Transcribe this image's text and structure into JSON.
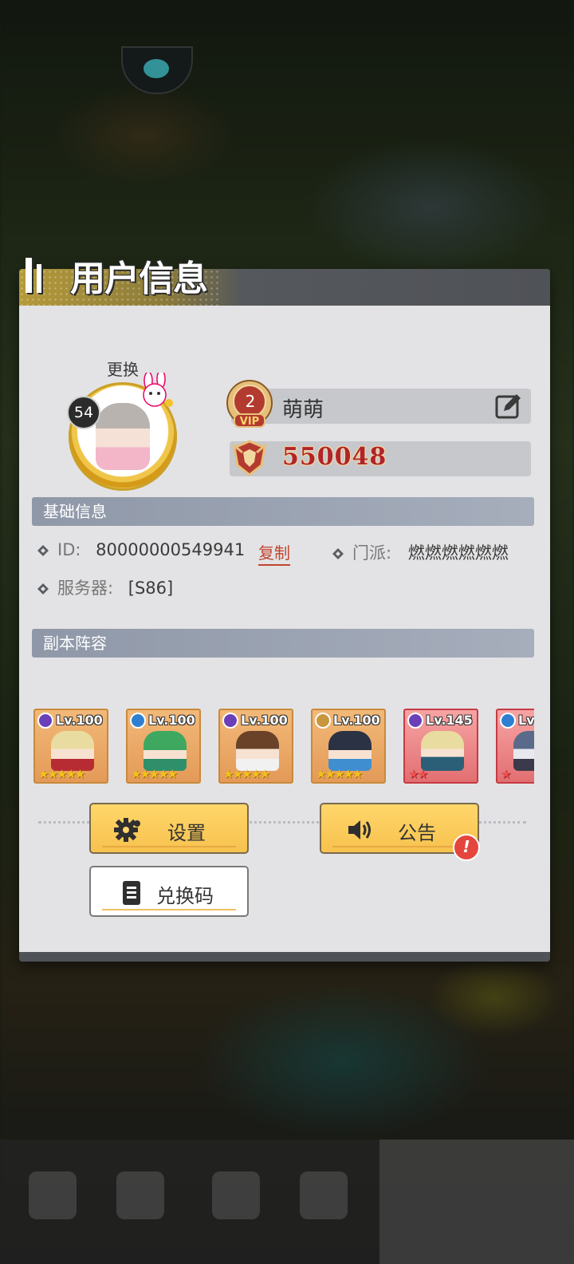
{
  "panel": {
    "title": "用户信息",
    "change_label": "更换"
  },
  "profile": {
    "level": "54",
    "vip_level": "2",
    "vip_text": "VIP",
    "name": "萌萌",
    "power": "550048"
  },
  "basic_info": {
    "header": "基础信息",
    "id_label": "ID:",
    "id_value": "80000000549941",
    "copy_label": "复制",
    "faction_label": "门派:",
    "faction_value": "燃燃燃燃燃燃",
    "server_label": "服务器:",
    "server_value": "[S86]"
  },
  "lineup": {
    "header": "副本阵容",
    "heroes": [
      {
        "level": "Lv.100",
        "element": "dark",
        "stars": "★★★★★"
      },
      {
        "level": "Lv.100",
        "element": "water",
        "stars": "★★★★★"
      },
      {
        "level": "Lv.100",
        "element": "dark",
        "stars": "★★★★★"
      },
      {
        "level": "Lv.100",
        "element": "earth",
        "stars": "★★★★★"
      },
      {
        "level": "Lv.145",
        "element": "dark",
        "stars": "★★"
      },
      {
        "level": "Lv",
        "element": "water",
        "stars": "★"
      }
    ]
  },
  "buttons": {
    "settings": "设置",
    "notice": "公告",
    "notice_badge": "!",
    "redeem": "兑换码"
  },
  "colors": {
    "accent_gold": "#f7c24e",
    "power_red": "#b0242c",
    "copy_red": "#c1442f",
    "section_header": "#9aa2b2"
  }
}
